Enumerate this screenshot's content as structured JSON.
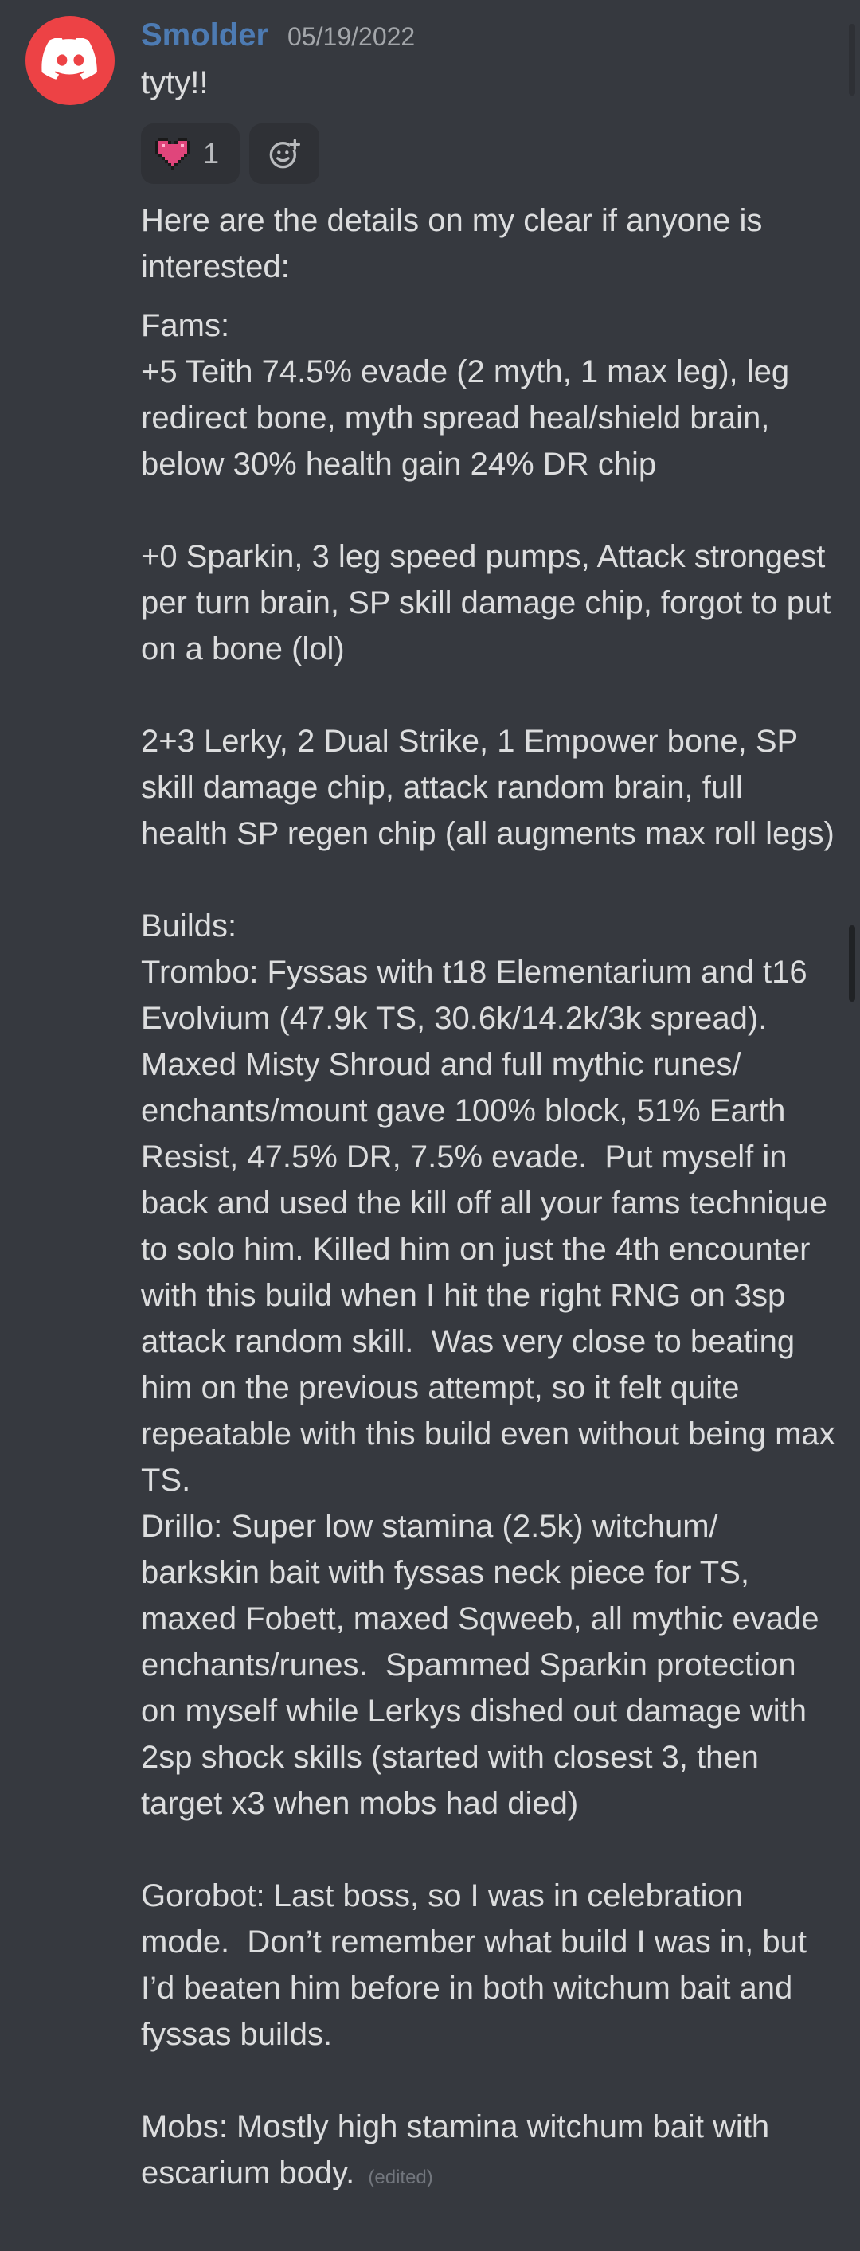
{
  "message": {
    "username": "Smolder",
    "timestamp": "05/19/2022",
    "short_text": "tyty!!",
    "reactions": [
      {
        "emoji": "pixel-heart",
        "count": "1"
      },
      {
        "emoji": "add-reaction-icon"
      }
    ],
    "body": {
      "intro": "Here are the details on my clear if anyone is interested:",
      "fams_label": "Fams:",
      "fam1": "+5 Teith 74.5% evade (2 myth, 1 max leg), leg redirect bone, myth spread heal/shield brain, below 30% health gain 24% DR chip",
      "fam2": "+0 Sparkin, 3 leg speed pumps, Attack strongest per turn brain, SP skill damage chip, forgot to put on a bone (lol)",
      "fam3": "2+3 Lerky, 2 Dual Strike, 1 Empower bone, SP skill damage chip, attack random brain, full health SP regen chip (all augments max roll legs)",
      "builds_label": "Builds:",
      "trombo": "Trombo: Fyssas with t18 Elementarium and t16 Evolvium (47.9k TS, 30.6k/14.2k/3k spread). Maxed Misty Shroud and full mythic runes/ enchants/mount gave 100% block, 51% Earth Resist, 47.5% DR, 7.5% evade.  Put myself in back and used the kill off all your fams technique to solo him. Killed him on just the 4th encounter with this build when I hit the right RNG on 3sp attack random skill.  Was very close to beating him on the previous attempt, so it felt quite repeatable with this build even without being max TS.",
      "drillo": "Drillo: Super low stamina (2.5k) witchum/ barkskin bait with fyssas neck piece for TS, maxed Fobett, maxed Sqweeb, all mythic evade enchants/runes.  Spammed Sparkin protection on myself while Lerkys dished out damage with 2sp shock skills (started with closest 3, then target x3 when mobs had died)",
      "gorobot": "Gorobot: Last boss, so I was in celebration mode.  Don’t remember what build I was in, but I’d beaten him before in both witchum bait and fyssas builds.",
      "mobs": "Mobs: Mostly high stamina witchum bait with escarium body.",
      "edited_marker": "(edited)"
    }
  },
  "colors": {
    "background": "#36393f",
    "username": "#4d7bb3",
    "avatar": "#ed4245",
    "text": "#dcddde",
    "muted": "#a3a6aa"
  }
}
